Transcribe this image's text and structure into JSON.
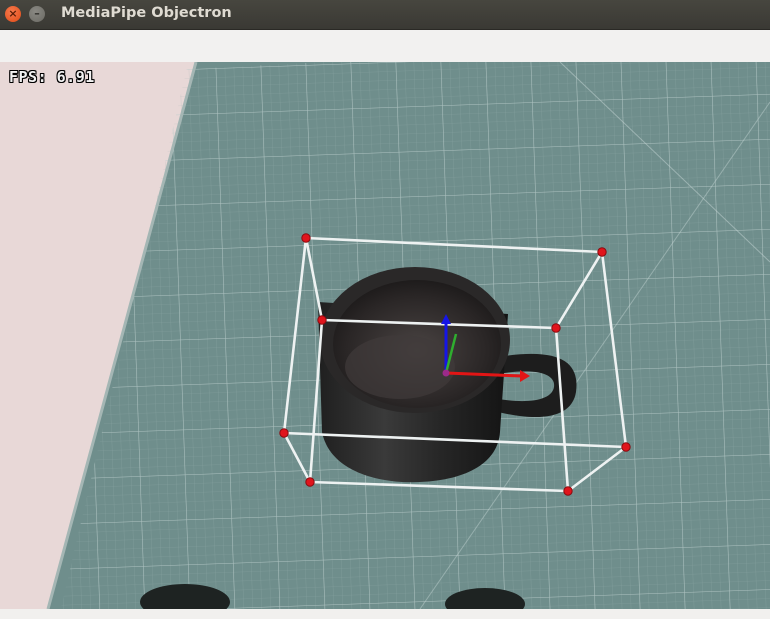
{
  "window": {
    "title": "MediaPipe Objectron",
    "close_glyph": "×",
    "minimize_glyph": "–"
  },
  "overlay": {
    "fps_label": "FPS:",
    "fps_value": "6.91"
  },
  "icons": {
    "close": "close-icon",
    "minimize": "minimize-icon"
  },
  "colors": {
    "titlebar": "#3e3d38",
    "close_button": "#e95420",
    "cutting_mat": "#6f8f8d",
    "bounding_box": "#eef2f2",
    "keypoint": "#e0141c",
    "axis_x": "#e21515",
    "axis_y": "#2fae2f",
    "axis_z": "#1515e6"
  }
}
